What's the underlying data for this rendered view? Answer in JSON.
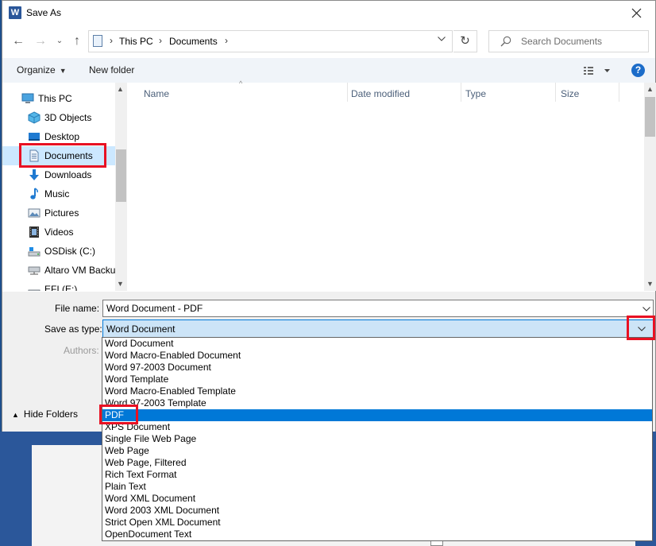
{
  "window": {
    "title": "Save As",
    "app_icon_letter": "W"
  },
  "nav_buttons": {
    "back": "←",
    "forward": "→",
    "recent": "⌄",
    "up": "↑"
  },
  "address_bar": {
    "crumbs": [
      "This PC",
      "Documents"
    ],
    "refresh": "↻"
  },
  "search": {
    "placeholder": "Search Documents"
  },
  "toolbar": {
    "organize": "Organize",
    "new_folder": "New folder",
    "help": "?"
  },
  "nav_pane": {
    "items": [
      {
        "label": "This PC",
        "icon": "computer-icon"
      },
      {
        "label": "3D Objects",
        "icon": "cube-icon"
      },
      {
        "label": "Desktop",
        "icon": "desktop-icon"
      },
      {
        "label": "Documents",
        "icon": "document-icon",
        "selected": true
      },
      {
        "label": "Downloads",
        "icon": "download-icon"
      },
      {
        "label": "Music",
        "icon": "music-icon"
      },
      {
        "label": "Pictures",
        "icon": "pictures-icon"
      },
      {
        "label": "Videos",
        "icon": "video-icon"
      },
      {
        "label": "OSDisk (C:)",
        "icon": "drive-icon"
      },
      {
        "label": "Altaro VM Backu",
        "icon": "network-drive-icon"
      },
      {
        "label": "EFI (E:)",
        "icon": "drive-icon"
      }
    ]
  },
  "file_list": {
    "columns": [
      "Name",
      "Date modified",
      "Type",
      "Size"
    ]
  },
  "form": {
    "file_name_label": "File name:",
    "file_name_value": "Word Document - PDF",
    "save_as_type_label": "Save as type:",
    "save_as_type_value": "Word Document",
    "authors_label": "Authors:",
    "hide_folders": "Hide Folders"
  },
  "save_type_options": [
    {
      "label": "Word Document"
    },
    {
      "label": "Word Macro-Enabled Document"
    },
    {
      "label": "Word 97-2003 Document"
    },
    {
      "label": "Word Template"
    },
    {
      "label": "Word Macro-Enabled Template"
    },
    {
      "label": "Word 97-2003 Template"
    },
    {
      "label": "PDF",
      "selected": true
    },
    {
      "label": "XPS Document"
    },
    {
      "label": "Single File Web Page"
    },
    {
      "label": "Web Page"
    },
    {
      "label": "Web Page, Filtered"
    },
    {
      "label": "Rich Text Format"
    },
    {
      "label": "Plain Text"
    },
    {
      "label": "Word XML Document"
    },
    {
      "label": "Word 2003 XML Document"
    },
    {
      "label": "Strict Open XML Document"
    },
    {
      "label": "OpenDocument Text"
    }
  ],
  "colors": {
    "highlight": "#e81123",
    "selection": "#0078d7",
    "nav_selected": "#cce8ff"
  }
}
